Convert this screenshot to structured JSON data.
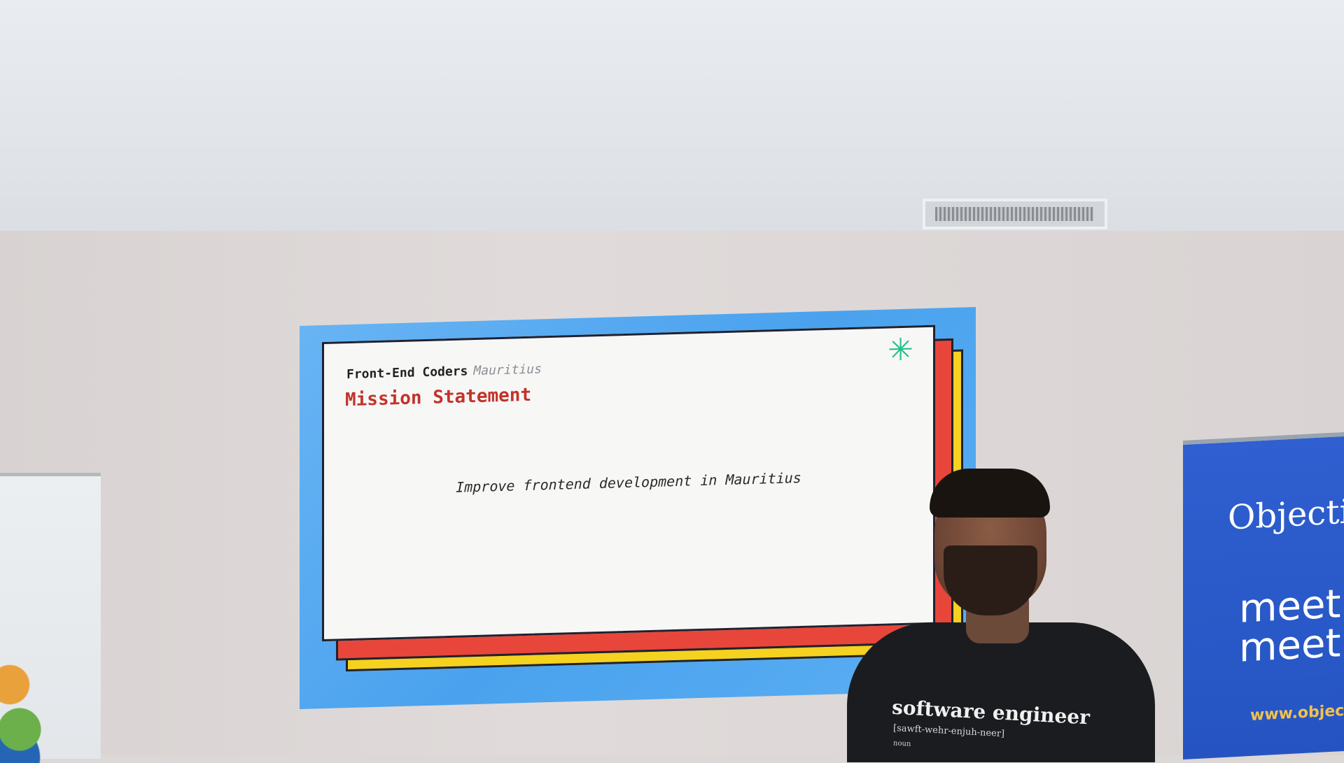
{
  "slide": {
    "org_name": "Front-End Coders",
    "org_location": "Mauritius",
    "title": "Mission Statement",
    "body": "Improve frontend development in Mauritius"
  },
  "right_banner": {
    "logo_text": "Objecti",
    "text": "meet\nmeet",
    "url": "www.objecti"
  },
  "speaker_shirt": {
    "heading": "software engineer",
    "pronunciation": "[sawft-wehr-enjuh-neer]",
    "part_of_speech": "noun"
  },
  "colors": {
    "screen_blue": "#4aa2ee",
    "card_red": "#e8463a",
    "card_yellow": "#f4d21f",
    "title_red": "#c2332b",
    "asterisk_green": "#27c08d",
    "banner_blue": "#2554c2"
  }
}
